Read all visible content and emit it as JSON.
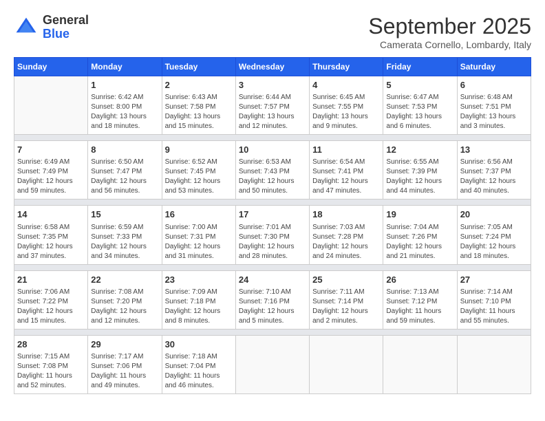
{
  "logo": {
    "general": "General",
    "blue": "Blue"
  },
  "title": "September 2025",
  "subtitle": "Camerata Cornello, Lombardy, Italy",
  "weekdays": [
    "Sunday",
    "Monday",
    "Tuesday",
    "Wednesday",
    "Thursday",
    "Friday",
    "Saturday"
  ],
  "weeks": [
    [
      {
        "day": "",
        "info": ""
      },
      {
        "day": "1",
        "info": "Sunrise: 6:42 AM\nSunset: 8:00 PM\nDaylight: 13 hours\nand 18 minutes."
      },
      {
        "day": "2",
        "info": "Sunrise: 6:43 AM\nSunset: 7:58 PM\nDaylight: 13 hours\nand 15 minutes."
      },
      {
        "day": "3",
        "info": "Sunrise: 6:44 AM\nSunset: 7:57 PM\nDaylight: 13 hours\nand 12 minutes."
      },
      {
        "day": "4",
        "info": "Sunrise: 6:45 AM\nSunset: 7:55 PM\nDaylight: 13 hours\nand 9 minutes."
      },
      {
        "day": "5",
        "info": "Sunrise: 6:47 AM\nSunset: 7:53 PM\nDaylight: 13 hours\nand 6 minutes."
      },
      {
        "day": "6",
        "info": "Sunrise: 6:48 AM\nSunset: 7:51 PM\nDaylight: 13 hours\nand 3 minutes."
      }
    ],
    [
      {
        "day": "7",
        "info": "Sunrise: 6:49 AM\nSunset: 7:49 PM\nDaylight: 12 hours\nand 59 minutes."
      },
      {
        "day": "8",
        "info": "Sunrise: 6:50 AM\nSunset: 7:47 PM\nDaylight: 12 hours\nand 56 minutes."
      },
      {
        "day": "9",
        "info": "Sunrise: 6:52 AM\nSunset: 7:45 PM\nDaylight: 12 hours\nand 53 minutes."
      },
      {
        "day": "10",
        "info": "Sunrise: 6:53 AM\nSunset: 7:43 PM\nDaylight: 12 hours\nand 50 minutes."
      },
      {
        "day": "11",
        "info": "Sunrise: 6:54 AM\nSunset: 7:41 PM\nDaylight: 12 hours\nand 47 minutes."
      },
      {
        "day": "12",
        "info": "Sunrise: 6:55 AM\nSunset: 7:39 PM\nDaylight: 12 hours\nand 44 minutes."
      },
      {
        "day": "13",
        "info": "Sunrise: 6:56 AM\nSunset: 7:37 PM\nDaylight: 12 hours\nand 40 minutes."
      }
    ],
    [
      {
        "day": "14",
        "info": "Sunrise: 6:58 AM\nSunset: 7:35 PM\nDaylight: 12 hours\nand 37 minutes."
      },
      {
        "day": "15",
        "info": "Sunrise: 6:59 AM\nSunset: 7:33 PM\nDaylight: 12 hours\nand 34 minutes."
      },
      {
        "day": "16",
        "info": "Sunrise: 7:00 AM\nSunset: 7:31 PM\nDaylight: 12 hours\nand 31 minutes."
      },
      {
        "day": "17",
        "info": "Sunrise: 7:01 AM\nSunset: 7:30 PM\nDaylight: 12 hours\nand 28 minutes."
      },
      {
        "day": "18",
        "info": "Sunrise: 7:03 AM\nSunset: 7:28 PM\nDaylight: 12 hours\nand 24 minutes."
      },
      {
        "day": "19",
        "info": "Sunrise: 7:04 AM\nSunset: 7:26 PM\nDaylight: 12 hours\nand 21 minutes."
      },
      {
        "day": "20",
        "info": "Sunrise: 7:05 AM\nSunset: 7:24 PM\nDaylight: 12 hours\nand 18 minutes."
      }
    ],
    [
      {
        "day": "21",
        "info": "Sunrise: 7:06 AM\nSunset: 7:22 PM\nDaylight: 12 hours\nand 15 minutes."
      },
      {
        "day": "22",
        "info": "Sunrise: 7:08 AM\nSunset: 7:20 PM\nDaylight: 12 hours\nand 12 minutes."
      },
      {
        "day": "23",
        "info": "Sunrise: 7:09 AM\nSunset: 7:18 PM\nDaylight: 12 hours\nand 8 minutes."
      },
      {
        "day": "24",
        "info": "Sunrise: 7:10 AM\nSunset: 7:16 PM\nDaylight: 12 hours\nand 5 minutes."
      },
      {
        "day": "25",
        "info": "Sunrise: 7:11 AM\nSunset: 7:14 PM\nDaylight: 12 hours\nand 2 minutes."
      },
      {
        "day": "26",
        "info": "Sunrise: 7:13 AM\nSunset: 7:12 PM\nDaylight: 11 hours\nand 59 minutes."
      },
      {
        "day": "27",
        "info": "Sunrise: 7:14 AM\nSunset: 7:10 PM\nDaylight: 11 hours\nand 55 minutes."
      }
    ],
    [
      {
        "day": "28",
        "info": "Sunrise: 7:15 AM\nSunset: 7:08 PM\nDaylight: 11 hours\nand 52 minutes."
      },
      {
        "day": "29",
        "info": "Sunrise: 7:17 AM\nSunset: 7:06 PM\nDaylight: 11 hours\nand 49 minutes."
      },
      {
        "day": "30",
        "info": "Sunrise: 7:18 AM\nSunset: 7:04 PM\nDaylight: 11 hours\nand 46 minutes."
      },
      {
        "day": "",
        "info": ""
      },
      {
        "day": "",
        "info": ""
      },
      {
        "day": "",
        "info": ""
      },
      {
        "day": "",
        "info": ""
      }
    ]
  ]
}
